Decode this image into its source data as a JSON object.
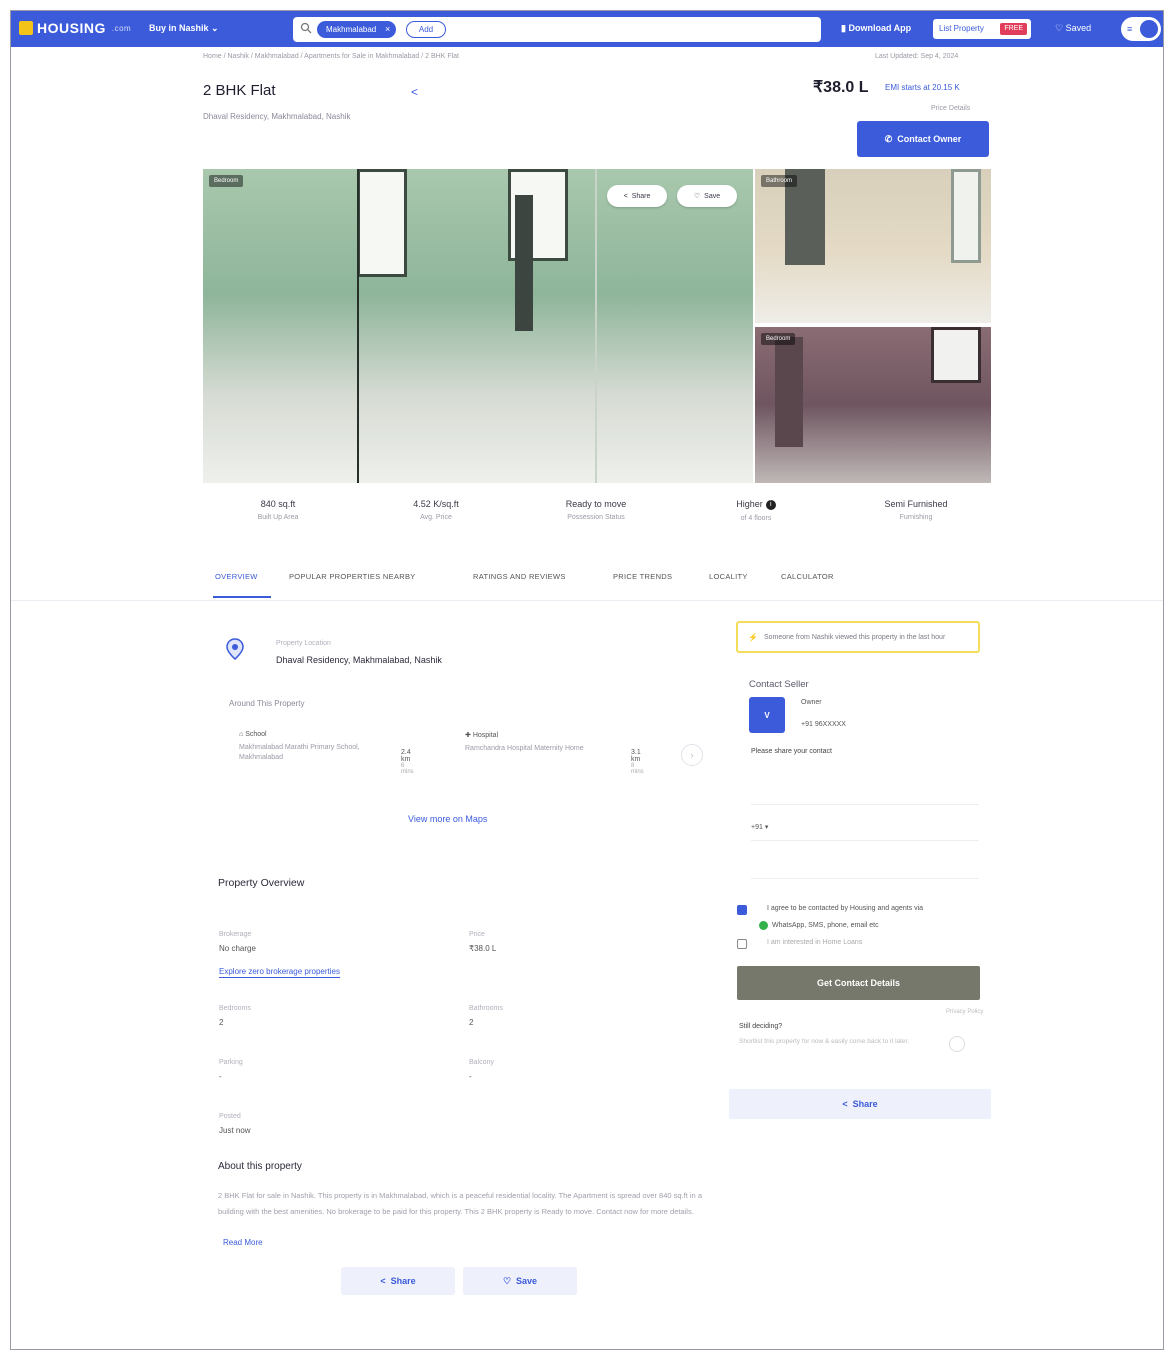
{
  "header": {
    "logo_text": "HOUSING",
    "logo_domain": ".com",
    "buy_dropdown": "Buy in Nashik",
    "search_chip": "Makhmalabad",
    "search_add": "Add",
    "download_app": "Download App",
    "list_property": "List Property",
    "free_badge": "FREE",
    "saved": "Saved",
    "menu_icon": "hamburger-icon"
  },
  "breadcrumb": "Home / Nashik / Makhmalabad / Apartments for Sale in Makhmalabad / 2 BHK Flat",
  "last_updated": "Last Updated: Sep 4, 2024",
  "listing": {
    "title": "2 BHK Flat",
    "subtitle": "Dhaval Residency, Makhmalabad, Nashik",
    "price": "₹38.0 L",
    "emi": "EMI starts at 20.15 K",
    "price_note": "Price Details",
    "contact_owner": "Contact Owner"
  },
  "gallery": {
    "tag_main": "Bedroom",
    "tag_top": "Bathroom",
    "tag_bottom": "Bedroom",
    "share": "Share",
    "save": "Save"
  },
  "stats": [
    {
      "value": "840 sq.ft",
      "label": "Built Up Area"
    },
    {
      "value": "4.52 K/sq.ft",
      "label": "Avg. Price"
    },
    {
      "value": "Ready to move",
      "label": "Possession Status"
    },
    {
      "value": "Higher",
      "label": "of 4 floors"
    },
    {
      "value": "Semi Furnished",
      "label": "Furnishing"
    }
  ],
  "tabs": [
    "OVERVIEW",
    "POPULAR PROPERTIES NEARBY",
    "RATINGS AND REVIEWS",
    "PRICE TRENDS",
    "LOCALITY",
    "CALCULATOR"
  ],
  "location": {
    "label": "Property Location",
    "value": "Dhaval Residency, Makhmalabad, Nashik",
    "around_label": "Around This Property",
    "pois": [
      {
        "type": "School",
        "name": "Makhmalabad Marathi Primary School, Makhmalabad",
        "distance": "2.4 km",
        "time": "6 mins"
      },
      {
        "type": "Hospital",
        "name": "Ramchandra Hospital Maternity Home",
        "distance": "3.1 km",
        "time": "8 mins"
      }
    ],
    "view_maps": "View more on Maps"
  },
  "overview": {
    "title": "Property Overview",
    "items": [
      {
        "label": "Brokerage",
        "value": "No charge"
      },
      {
        "label": "Price",
        "value": "₹38.0 L"
      },
      {
        "label": "Bedrooms",
        "value": "2"
      },
      {
        "label": "Bathrooms",
        "value": "2"
      },
      {
        "label": "Parking",
        "value": "-"
      },
      {
        "label": "Balcony",
        "value": "-"
      },
      {
        "label": "Posted",
        "value": "Just now"
      }
    ],
    "brokerage_link": "Explore zero brokerage properties"
  },
  "about": {
    "title": "About this property",
    "text": "2 BHK Flat for sale in Nashik. This property is in Makhmalabad, which is a peaceful residential locality. The Apartment is spread over 840 sq.ft in a building with the best amenities. No brokerage to be paid for this property. This 2 BHK property is Ready to move. Contact now for more details.",
    "read_more": "Read More",
    "share": "Share",
    "save": "Save"
  },
  "sidebar": {
    "notice": "Someone from Nashik viewed this property in the last hour",
    "contact_title": "Contact Seller",
    "seller_initial": "V",
    "seller_role": "Owner",
    "seller_phone": "+91 96XXXXX",
    "share_contact": "Please share your contact",
    "phone_prefix": "+91",
    "agree_text": "I agree to be contacted by Housing and agents via",
    "whatsapp_text": "WhatsApp, SMS, phone, email etc",
    "home_loan": "I am interested in Home Loans",
    "get_contact": "Get Contact Details",
    "privacy": "Privacy Policy",
    "still_deciding": "Still deciding?",
    "still_sub": "Shortlist this property for now & easily come back to it later.",
    "share": "Share"
  },
  "colors": {
    "brand": "#3b5bdb",
    "notice_border": "#f4dd5a",
    "cta_disabled": "#76786b"
  }
}
